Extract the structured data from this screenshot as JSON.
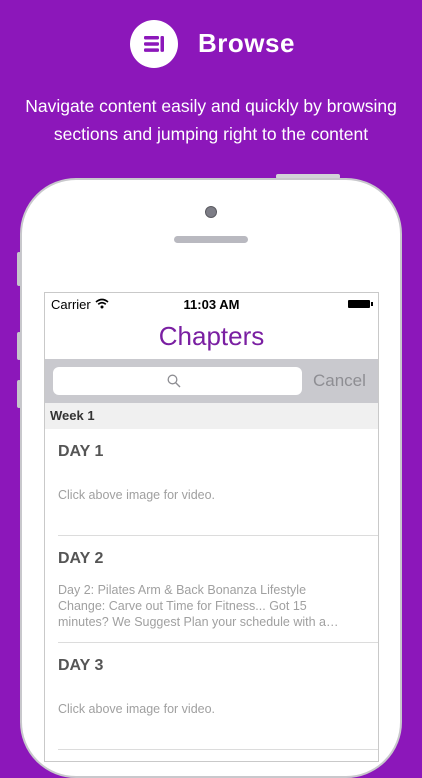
{
  "promo": {
    "icon": "list-menu-icon",
    "title": "Browse",
    "subtitle": "Navigate content easily and quickly by browsing\nsections and jumping right to the content"
  },
  "status_bar": {
    "carrier": "Carrier",
    "wifi_icon": "wifi-icon",
    "time": "11:03 AM",
    "battery_icon": "battery-icon"
  },
  "nav": {
    "title": "Chapters"
  },
  "search": {
    "placeholder": "",
    "icon": "search-icon",
    "cancel_label": "Cancel"
  },
  "section": {
    "header": "Week 1"
  },
  "items": [
    {
      "title": "DAY 1",
      "description": "Click above image for video."
    },
    {
      "title": "DAY 2",
      "description": "Day 2: Pilates Arm & Back Bonanza Lifestyle\nChange: Carve out Time for Fitness... Got 15\nminutes? We Suggest Plan your schedule with a…"
    },
    {
      "title": "DAY 3",
      "description": "Click above image for video."
    }
  ],
  "colors": {
    "background": "#8c17ba",
    "accent": "#7a1fa2"
  }
}
